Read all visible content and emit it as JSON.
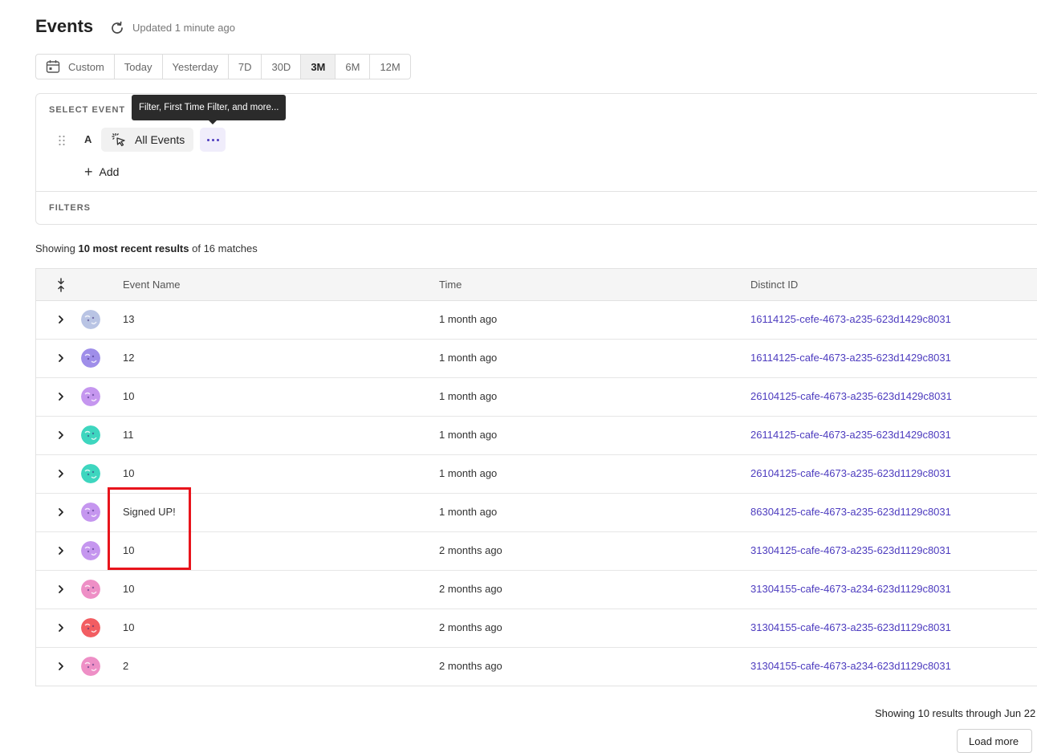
{
  "header": {
    "title": "Events",
    "updated_text": "Updated 1 minute ago"
  },
  "date_range": {
    "options": [
      "Custom",
      "Today",
      "Yesterday",
      "7D",
      "30D",
      "3M",
      "6M",
      "12M"
    ],
    "selected": "3M"
  },
  "select_event": {
    "section_label": "SELECT EVENT",
    "letter": "A",
    "event_label": "All Events",
    "add_label": "Add",
    "tooltip": "Filter, First Time Filter, and more..."
  },
  "filters": {
    "section_label": "FILTERS"
  },
  "summary": {
    "prefix": "Showing ",
    "bold": "10 most recent results",
    "suffix": " of 16 matches"
  },
  "table": {
    "columns": [
      "Event Name",
      "Time",
      "Distinct ID"
    ],
    "rows": [
      {
        "event": "13",
        "time": "1 month ago",
        "distinct_id": "16114125-cefe-4673-a235-623d1429c8031",
        "avatar_color": "#b9c4e4"
      },
      {
        "event": "12",
        "time": "1 month ago",
        "distinct_id": "16114125-cafe-4673-a235-623d1429c8031",
        "avatar_color": "#9f8ee9"
      },
      {
        "event": "10",
        "time": "1 month ago",
        "distinct_id": "26104125-cafe-4673-a235-623d1429c8031",
        "avatar_color": "#c596ef"
      },
      {
        "event": "11",
        "time": "1 month ago",
        "distinct_id": "26114125-cafe-4673-a235-623d1429c8031",
        "avatar_color": "#3ed6bf"
      },
      {
        "event": "10",
        "time": "1 month ago",
        "distinct_id": "26104125-cafe-4673-a235-623d1129c8031",
        "avatar_color": "#3ed6bf"
      },
      {
        "event": "Signed UP!",
        "time": "1 month ago",
        "distinct_id": "86304125-cafe-4673-a235-623d1129c8031",
        "avatar_color": "#c596ef"
      },
      {
        "event": "10",
        "time": "2 months ago",
        "distinct_id": "31304125-cafe-4673-a235-623d1129c8031",
        "avatar_color": "#c596ef"
      },
      {
        "event": "10",
        "time": "2 months ago",
        "distinct_id": "31304155-cafe-4673-a234-623d1129c8031",
        "avatar_color": "#ee8fc6"
      },
      {
        "event": "10",
        "time": "2 months ago",
        "distinct_id": "31304155-cafe-4673-a235-623d1129c8031",
        "avatar_color": "#f25d62"
      },
      {
        "event": "2",
        "time": "2 months ago",
        "distinct_id": "31304155-cafe-4673-a234-623d1129c8031",
        "avatar_color": "#ee8fc6"
      }
    ]
  },
  "footer": {
    "results_text": "Showing 10 results through Jun 22",
    "load_more_label": "Load more"
  },
  "colors": {
    "accent": "#4d3cbf",
    "highlight": "#e8141c"
  }
}
